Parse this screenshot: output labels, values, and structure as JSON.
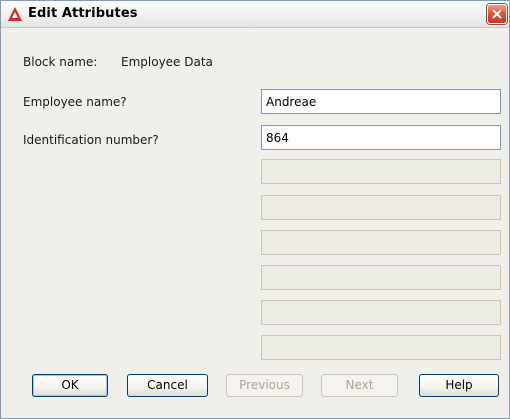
{
  "window": {
    "title": "Edit Attributes",
    "icon": "autocad-a-icon",
    "close_icon": "close-icon"
  },
  "block": {
    "label": "Block name:",
    "value": "Employee Data"
  },
  "attributes": [
    {
      "prompt": "Employee name?",
      "value": "Andreae"
    },
    {
      "prompt": "Identification number?",
      "value": "864"
    }
  ],
  "empty_fields_count_visible": 6,
  "buttons": {
    "ok": "OK",
    "cancel": "Cancel",
    "previous": "Previous",
    "next": "Next",
    "help": "Help"
  },
  "colors": {
    "close_button": "#e0543a",
    "app_icon": "#d62b1f"
  }
}
